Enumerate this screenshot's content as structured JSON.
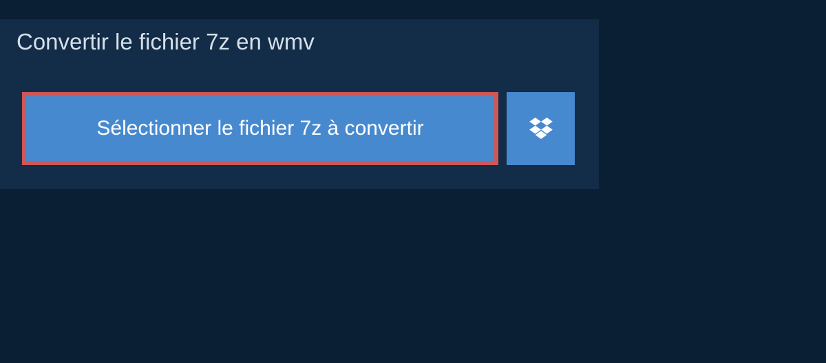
{
  "title": "Convertir le fichier 7z en wmv",
  "buttons": {
    "select_file": "Sélectionner le fichier 7z à convertir"
  },
  "colors": {
    "background": "#0a1f33",
    "panel": "#132c47",
    "button_primary": "#4789cf",
    "button_highlight_border": "#d15757",
    "text_light": "#d5e0ea",
    "text_white": "#ffffff"
  }
}
